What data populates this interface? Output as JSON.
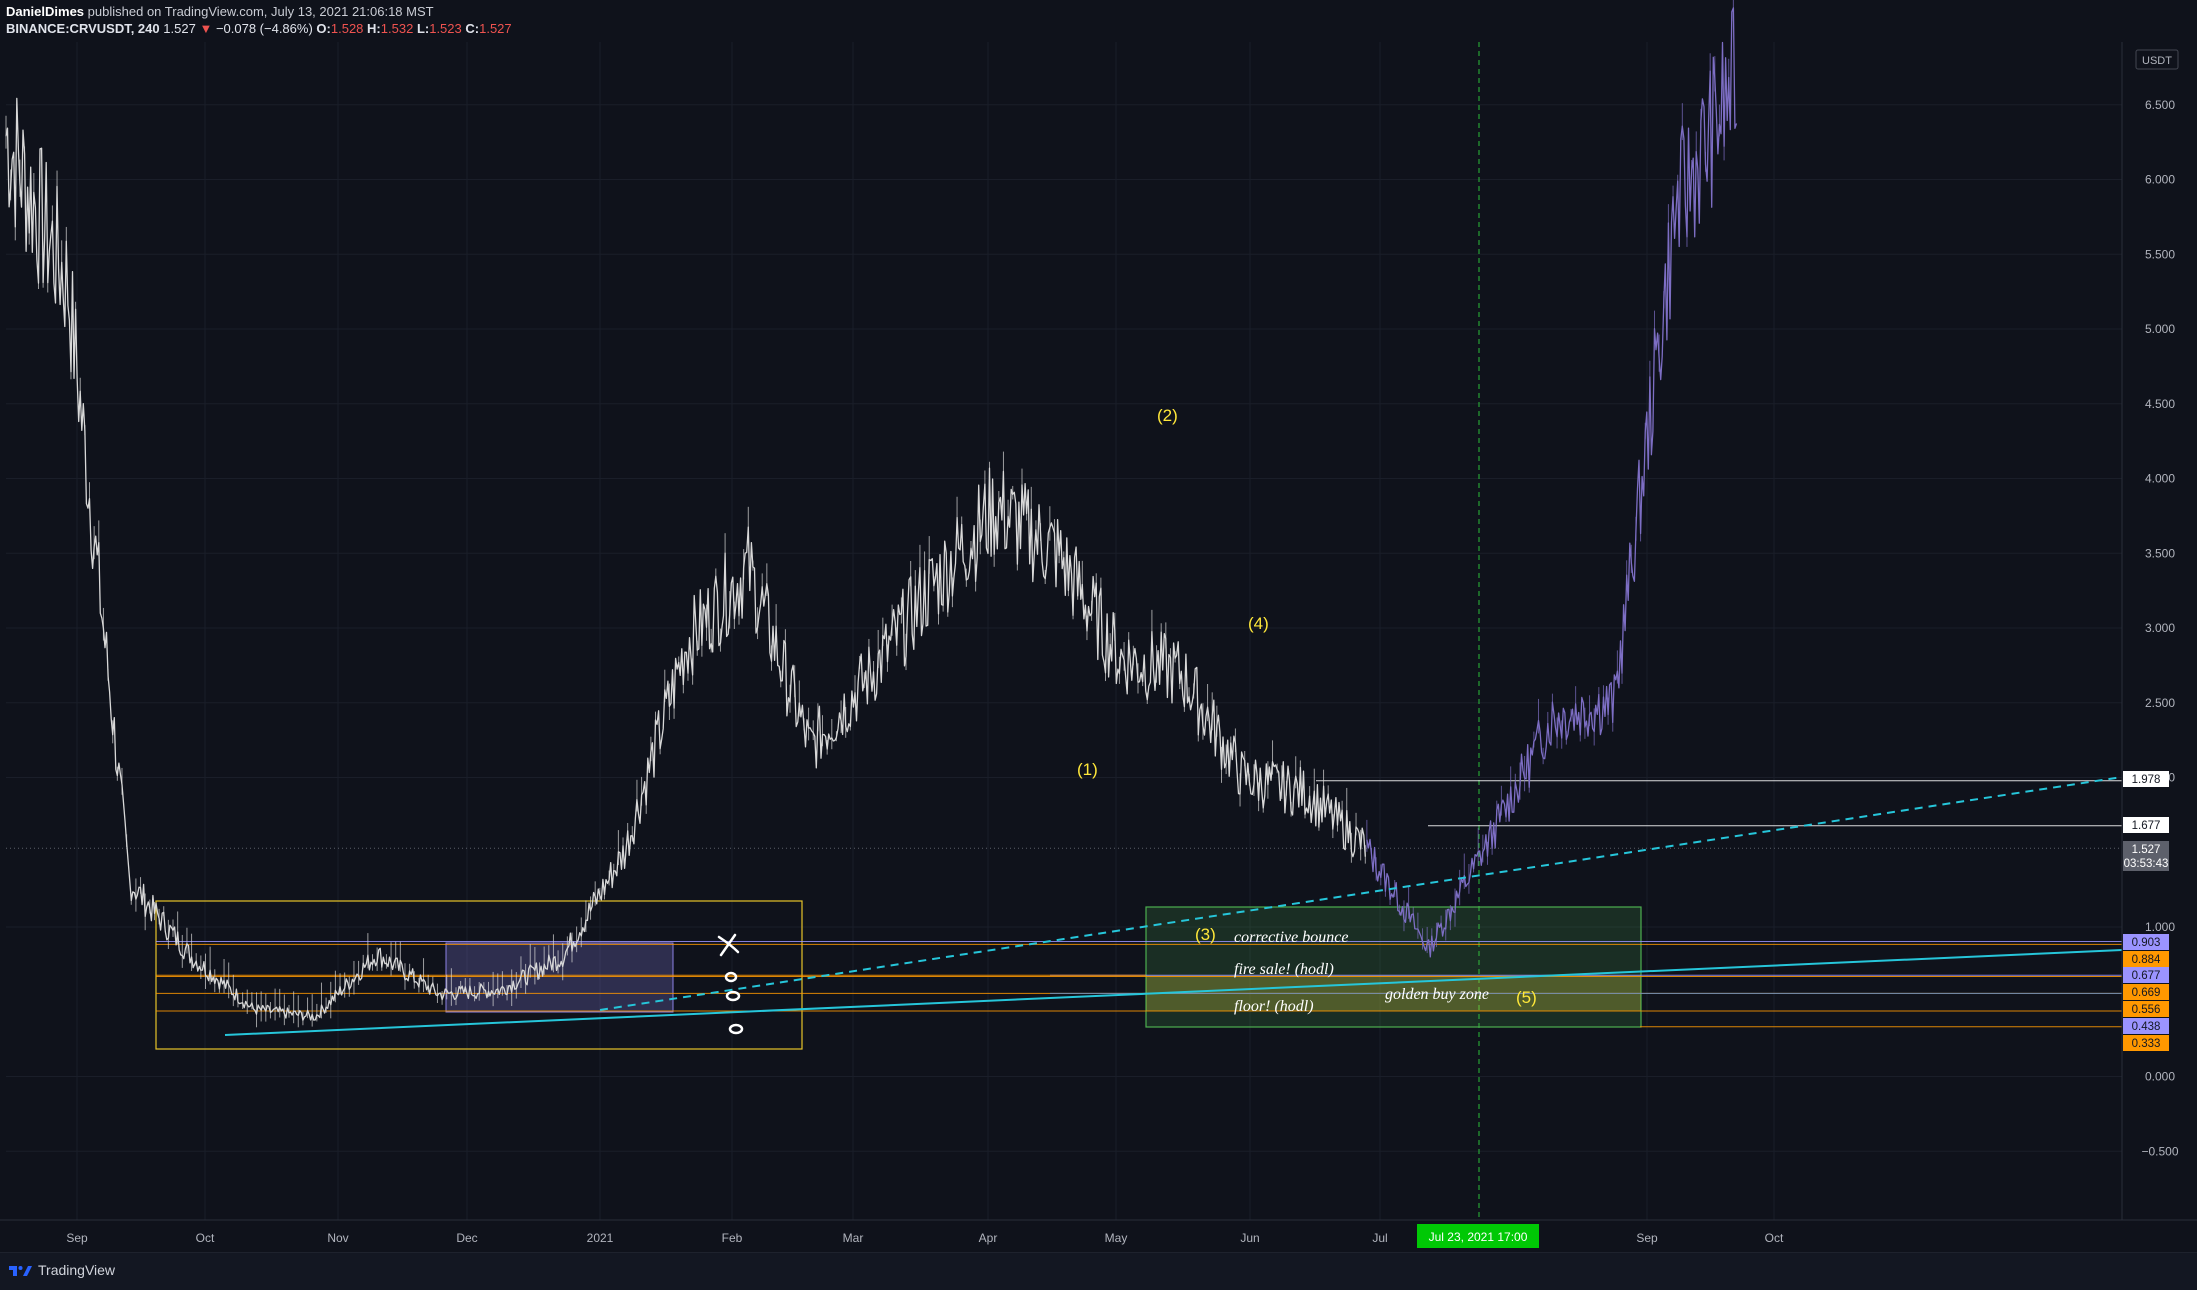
{
  "header": {
    "author": "DanielDimes",
    "published": "published on TradingView.com, July 13, 2021 21:06:18 MST",
    "symbol": "BINANCE:CRVUSDT, 240",
    "last": "1.527",
    "change": "−0.078 (−4.86%)",
    "o_label": "O:",
    "o": "1.528",
    "h_label": "H:",
    "h": "1.532",
    "l_label": "L:",
    "l": "1.523",
    "c_label": "C:",
    "c": "1.527"
  },
  "price_axis": {
    "currency": "USDT",
    "ticks": [
      "6.500",
      "6.000",
      "5.500",
      "5.000",
      "4.500",
      "4.000",
      "3.500",
      "3.000",
      "2.500",
      "2.000",
      "1.000",
      "0.000",
      "−0.500"
    ],
    "labels": [
      {
        "text": "1.978",
        "bg": "#ffffff",
        "fg": "#131722"
      },
      {
        "text": "1.677",
        "bg": "#ffffff",
        "fg": "#131722"
      },
      {
        "text": "1.527",
        "bg": "#5d606b",
        "fg": "#ffffff"
      },
      {
        "text": "03:53:43",
        "bg": "#5d606b",
        "fg": "#ffffff"
      },
      {
        "text": "0.903",
        "bg": "#9b94ff",
        "fg": "#131722"
      },
      {
        "text": "0.884",
        "bg": "#ff9800",
        "fg": "#131722"
      },
      {
        "text": "0.677",
        "bg": "#9b94ff",
        "fg": "#131722"
      },
      {
        "text": "0.669",
        "bg": "#ff9800",
        "fg": "#131722"
      },
      {
        "text": "0.556",
        "bg": "#ff9800",
        "fg": "#131722"
      },
      {
        "text": "0.438",
        "bg": "#9b94ff",
        "fg": "#131722"
      },
      {
        "text": "0.333",
        "bg": "#ff9800",
        "fg": "#131722"
      }
    ]
  },
  "time_axis": {
    "ticks": [
      "Sep",
      "Oct",
      "Nov",
      "Dec",
      "2021",
      "Feb",
      "Mar",
      "Apr",
      "May",
      "Jun",
      "Jul",
      "Sep",
      "Oct"
    ],
    "crosshair_label": "Jul 23, 2021   17:00"
  },
  "annotations": {
    "wave1": "(1)",
    "wave2": "(2)",
    "wave3": "(3)",
    "wave4": "(4)",
    "wave5": "(5)",
    "corrective": "corrective bounce",
    "fire_sale": "fire sale! (hodl)",
    "golden": "golden buy zone",
    "floor": "floor! (hodl)"
  },
  "colors": {
    "background": "#0f121b",
    "price_white": "#d8d8d8",
    "projection_purple": "#7d6ec4",
    "trendline_cyan": "#26c6da",
    "box_yellow": "#e6c229",
    "level_orange": "#ff9800",
    "zone_green": "#4caf50",
    "label_yellow": "#ffe83a",
    "crosshair_green": "#00c805"
  },
  "footer": {
    "brand": "TradingView"
  },
  "chart_data": {
    "type": "line",
    "title": "BINANCE:CRVUSDT, 240",
    "xlabel": "",
    "ylabel": "USDT",
    "ylim": [
      -0.75,
      6.85
    ],
    "x": [
      "Aug 15",
      "Aug 28",
      "Sep 15",
      "Oct 1",
      "Oct 15",
      "Nov 1",
      "Nov 15",
      "Dec 1",
      "Dec 15",
      "Jan 1",
      "Jan 15",
      "Feb 1",
      "Feb 15",
      "Mar 1",
      "Mar 15",
      "Apr 1",
      "Apr 15",
      "May 1",
      "May 15",
      "Jun 1",
      "Jun 15",
      "Jul 1",
      "Jul 13",
      "Jul 23",
      "Aug 1",
      "Aug 15",
      "Sep 1",
      "Sep 10",
      "Sep 20"
    ],
    "series": [
      {
        "name": "",
        "values": [
          6.3,
          5.3,
          1.3,
          0.8,
          0.45,
          0.4,
          0.82,
          0.55,
          0.58,
          0.8,
          1.5,
          2.9,
          3.4,
          2.2,
          2.7,
          3.3,
          3.8,
          3.5,
          2.8,
          2.7,
          2.0,
          1.9,
          1.527,
          null,
          null,
          null,
          null,
          null,
          null
        ]
      },
      {
        "name": "",
        "values": [
          null,
          null,
          null,
          null,
          null,
          null,
          null,
          null,
          null,
          null,
          null,
          null,
          null,
          null,
          null,
          null,
          null,
          null,
          null,
          null,
          null,
          null,
          1.527,
          0.85,
          1.6,
          2.4,
          2.5,
          5.8,
          6.7
        ]
      }
    ],
    "levels": [
      1.978,
      1.677,
      0.903,
      0.884,
      0.677,
      0.669,
      0.556,
      0.438,
      0.333
    ]
  }
}
